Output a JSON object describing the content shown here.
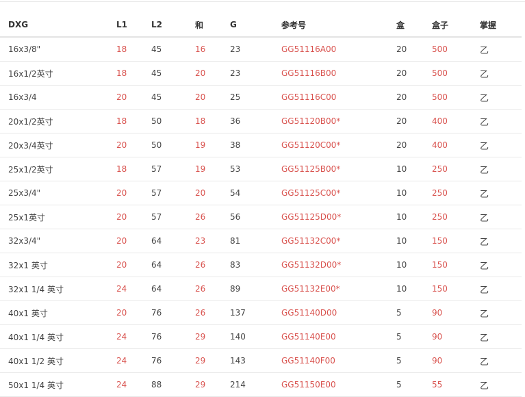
{
  "table": {
    "headers": [
      "DXG",
      "L1",
      "L2",
      "和",
      "G",
      "参考号",
      "盒",
      "盒子",
      "掌握"
    ],
    "rows": [
      [
        "16x3/8\"",
        "18",
        "45",
        "16",
        "23",
        "GG51116A00",
        "20",
        "500",
        "乙"
      ],
      [
        "16x1/2英寸",
        "18",
        "45",
        "20",
        "23",
        "GG51116B00",
        "20",
        "500",
        "乙"
      ],
      [
        "16x3/4",
        "20",
        "45",
        "20",
        "25",
        "GG51116C00",
        "20",
        "500",
        "乙"
      ],
      [
        "20x1/2英寸",
        "18",
        "50",
        "18",
        "36",
        "GG51120B00*",
        "20",
        "400",
        "乙"
      ],
      [
        "20x3/4英寸",
        "20",
        "50",
        "19",
        "38",
        "GG51120C00*",
        "20",
        "400",
        "乙"
      ],
      [
        "25x1/2英寸",
        "18",
        "57",
        "19",
        "53",
        "GG51125B00*",
        "10",
        "250",
        "乙"
      ],
      [
        "25x3/4\"",
        "20",
        "57",
        "20",
        "54",
        "GG51125C00*",
        "10",
        "250",
        "乙"
      ],
      [
        "25x1英寸",
        "20",
        "57",
        "26",
        "56",
        "GG51125D00*",
        "10",
        "250",
        "乙"
      ],
      [
        "32x3/4\"",
        "20",
        "64",
        "23",
        "81",
        "GG51132C00*",
        "10",
        "150",
        "乙"
      ],
      [
        "32x1 英寸",
        "20",
        "64",
        "26",
        "83",
        "GG51132D00*",
        "10",
        "150",
        "乙"
      ],
      [
        "32x1 1/4 英寸",
        "24",
        "64",
        "26",
        "89",
        "GG51132E00*",
        "10",
        "150",
        "乙"
      ],
      [
        "40x1 英寸",
        "20",
        "76",
        "26",
        "137",
        "GG51140D00",
        "5",
        "90",
        "乙"
      ],
      [
        "40x1 1/4 英寸",
        "24",
        "76",
        "29",
        "140",
        "GG51140E00",
        "5",
        "90",
        "乙"
      ],
      [
        "40x1 1/2 英寸",
        "24",
        "76",
        "29",
        "143",
        "GG51140F00",
        "5",
        "90",
        "乙"
      ],
      [
        "50x1 1/4 英寸",
        "24",
        "88",
        "29",
        "214",
        "GG51150E00",
        "5",
        "55",
        "乙"
      ]
    ]
  },
  "colors": {
    "accent_red": "#d9534f",
    "text": "#444444",
    "border": "#e8e8e8"
  }
}
